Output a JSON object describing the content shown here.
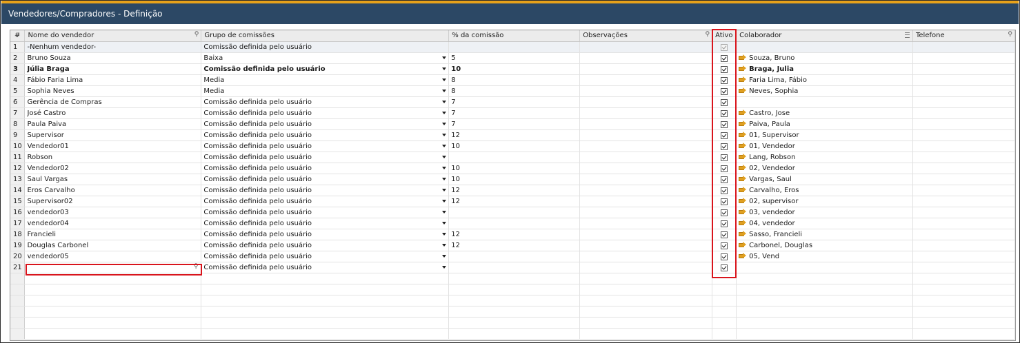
{
  "window": {
    "title": "Vendedores/Compradores - Definição"
  },
  "columns": {
    "num": "#",
    "name": "Nome do vendedor",
    "group": "Grupo de comissões",
    "pct": "% da comissão",
    "obs": "Observações",
    "active": "Ativo",
    "collab": "Colaborador",
    "phone": "Telefone"
  },
  "rows": [
    {
      "n": "1",
      "name": "-Nenhum vendedor-",
      "group": "Comissão definida pelo usuário",
      "pct": "",
      "active": true,
      "collab": "",
      "first": true
    },
    {
      "n": "2",
      "name": "Bruno Souza",
      "group": "Baixa",
      "pct": "5",
      "active": true,
      "collab": "Souza, Bruno"
    },
    {
      "n": "3",
      "name": "Júlia Braga",
      "group": "Comissão definida pelo usuário",
      "pct": "10",
      "active": true,
      "collab": "Braga, Julia",
      "bold": true
    },
    {
      "n": "4",
      "name": "Fábio Faria Lima",
      "group": "Media",
      "pct": "8",
      "active": true,
      "collab": "Faria Lima, Fábio"
    },
    {
      "n": "5",
      "name": "Sophia Neves",
      "group": "Media",
      "pct": "8",
      "active": true,
      "collab": "Neves, Sophia"
    },
    {
      "n": "6",
      "name": "Gerência de Compras",
      "group": "Comissão definida pelo usuário",
      "pct": "7",
      "active": true,
      "collab": ""
    },
    {
      "n": "7",
      "name": "José Castro",
      "group": "Comissão definida pelo usuário",
      "pct": "7",
      "active": true,
      "collab": "Castro, Jose"
    },
    {
      "n": "8",
      "name": "Paula Paiva",
      "group": "Comissão definida pelo usuário",
      "pct": "7",
      "active": true,
      "collab": "Paiva, Paula"
    },
    {
      "n": "9",
      "name": "Supervisor",
      "group": "Comissão definida pelo usuário",
      "pct": "12",
      "active": true,
      "collab": "01, Supervisor"
    },
    {
      "n": "10",
      "name": "Vendedor01",
      "group": "Comissão definida pelo usuário",
      "pct": "10",
      "active": true,
      "collab": "01, Vendedor"
    },
    {
      "n": "11",
      "name": "Robson",
      "group": "Comissão definida pelo usuário",
      "pct": "",
      "active": true,
      "collab": "Lang, Robson"
    },
    {
      "n": "12",
      "name": "Vendedor02",
      "group": "Comissão definida pelo usuário",
      "pct": "10",
      "active": true,
      "collab": "02, Vendedor"
    },
    {
      "n": "13",
      "name": "Saul Vargas",
      "group": "Comissão definida pelo usuário",
      "pct": "10",
      "active": true,
      "collab": "Vargas, Saul"
    },
    {
      "n": "14",
      "name": "Eros Carvalho",
      "group": "Comissão definida pelo usuário",
      "pct": "12",
      "active": true,
      "collab": "Carvalho, Eros"
    },
    {
      "n": "15",
      "name": "Supervisor02",
      "group": "Comissão definida pelo usuário",
      "pct": "12",
      "active": true,
      "collab": "02, supervisor"
    },
    {
      "n": "16",
      "name": "vendedor03",
      "group": "Comissão definida pelo usuário",
      "pct": "",
      "active": true,
      "collab": "03, vendedor"
    },
    {
      "n": "17",
      "name": "vendedor04",
      "group": "Comissão definida pelo usuário",
      "pct": "",
      "active": true,
      "collab": "04, vendedor"
    },
    {
      "n": "18",
      "name": "Francieli",
      "group": "Comissão definida pelo usuário",
      "pct": "12",
      "active": true,
      "collab": "Sasso, Francieli"
    },
    {
      "n": "19",
      "name": "Douglas Carbonel",
      "group": "Comissão definida pelo usuário",
      "pct": "12",
      "active": true,
      "collab": "Carbonel, Douglas"
    },
    {
      "n": "20",
      "name": "vendedor05",
      "group": "Comissão definida pelo usuário",
      "pct": "",
      "active": true,
      "collab": "05, Vend"
    },
    {
      "n": "21",
      "name": "",
      "group": "Comissão definida pelo usuário",
      "pct": "",
      "active": true,
      "collab": "",
      "editing": true
    }
  ],
  "empty_rows": 6,
  "colors": {
    "title_bar": "#2c4865",
    "accent": "#e8a21a",
    "highlight_box": "#d9141c",
    "arrow": "#e0a020"
  }
}
